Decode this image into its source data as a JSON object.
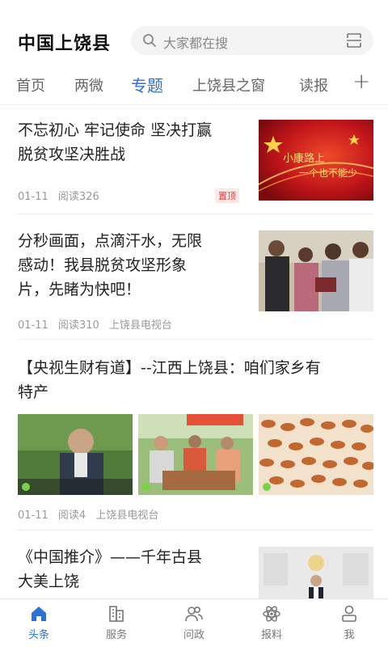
{
  "header": {
    "title": "中国上饶县",
    "search_placeholder": "大家都在搜"
  },
  "tabs": [
    {
      "label": "首页"
    },
    {
      "label": "两微"
    },
    {
      "label": "专题"
    },
    {
      "label": "上饶县之窗"
    },
    {
      "label": "读报"
    }
  ],
  "tab_plus": "+",
  "feed": [
    {
      "title_line1": "不忘初心 牢记使命 坚决打赢",
      "title_line2": "脱贫攻坚决胜战",
      "date": "01-11",
      "reads": "阅读326",
      "badge": "置顶",
      "thumb_text_line1": "小康路上",
      "thumb_text_line2": "一个也不能少"
    },
    {
      "title_line1": "分秒画面，点滴汗水，无限",
      "title_line2": "感动！我县脱贫攻坚形象",
      "title_line3": "片，先睹为快吧！",
      "date": "01-11",
      "reads": "阅读310",
      "source": "上饶县电视台"
    },
    {
      "title_line1": "【央视生财有道】--江西上饶县：咱们家乡有",
      "title_line2": "特产",
      "date": "01-11",
      "reads": "阅读4",
      "source": "上饶县电视台"
    },
    {
      "title_line1": "《中国推介》——千年古县",
      "title_line2": "大美上饶"
    }
  ],
  "bottom_nav": [
    {
      "label": "头条",
      "icon": "home-icon"
    },
    {
      "label": "服务",
      "icon": "building-icon"
    },
    {
      "label": "问政",
      "icon": "people-icon"
    },
    {
      "label": "报料",
      "icon": "atom-icon"
    },
    {
      "label": "我",
      "icon": "user-icon"
    }
  ],
  "colors": {
    "accent": "#2a72d4",
    "badge": "#e0413d"
  }
}
